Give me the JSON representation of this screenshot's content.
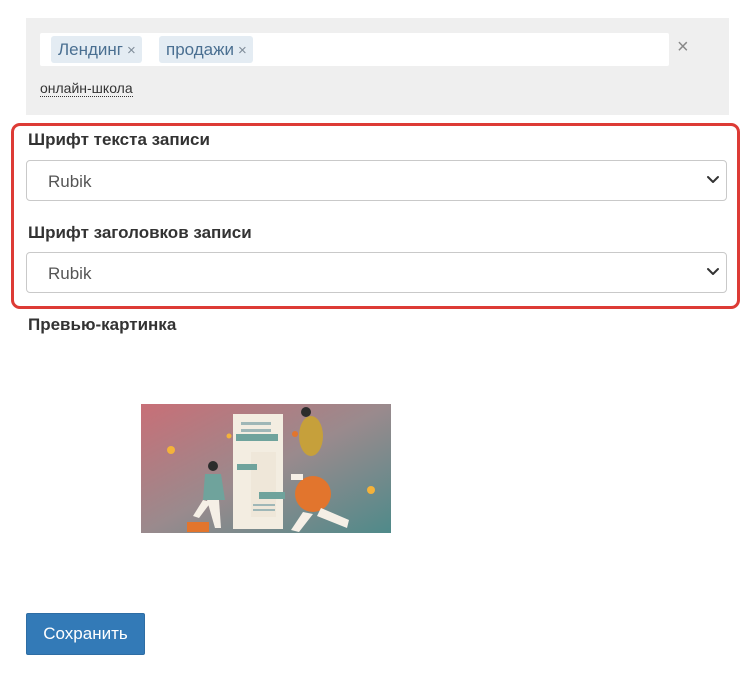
{
  "tags": {
    "items": [
      {
        "label": "Лендинг"
      },
      {
        "label": "продажи"
      }
    ],
    "remove_glyph": "×",
    "clear_all_glyph": "×",
    "suggestion": "онлайн-школа"
  },
  "fonts": {
    "body_font_label": "Шрифт текста записи",
    "body_font_value": "Rubik",
    "heading_font_label": "Шрифт заголовков записи",
    "heading_font_value": "Rubik"
  },
  "preview": {
    "label": "Превью-картинка"
  },
  "actions": {
    "save_label": "Сохранить"
  },
  "colors": {
    "highlight_border": "#dd3b35",
    "primary_button": "#337ab7",
    "tag_background": "#e4ecf3"
  }
}
